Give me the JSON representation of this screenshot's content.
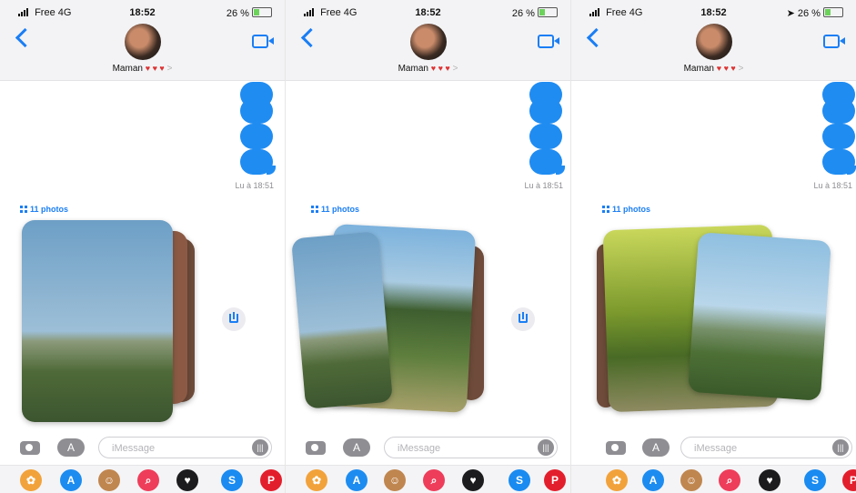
{
  "screens": [
    {
      "status": {
        "carrier": "Free",
        "network": "4G",
        "time": "18:52",
        "battery": "26 %"
      },
      "contact": {
        "name": "Maman",
        "hearts": "♥ ♥ ♥",
        "chevron": ">"
      },
      "read_receipt": "Lu à 18:51",
      "photos_label": "11 photos",
      "composer_placeholder": "iMessage"
    },
    {
      "status": {
        "carrier": "Free",
        "network": "4G",
        "time": "18:52",
        "battery": "26 %"
      },
      "contact": {
        "name": "Maman",
        "hearts": "♥ ♥ ♥",
        "chevron": ">"
      },
      "read_receipt": "Lu à 18:51",
      "photos_label": "11 photos",
      "composer_placeholder": "iMessage"
    },
    {
      "status": {
        "carrier": "Free",
        "network": "4G",
        "time": "18:52",
        "battery": "26 %"
      },
      "contact": {
        "name": "Maman",
        "hearts": "♥ ♥ ♥",
        "chevron": ">"
      },
      "read_receipt": "Lu à 18:51",
      "photos_label": "11 photos",
      "composer_placeholder": "iMessage"
    }
  ],
  "icons": {
    "back": "chevron-left-icon",
    "video": "video-camera-icon",
    "camera": "camera-icon",
    "apps": "app-store-icon",
    "audio": "audio-waveform-icon",
    "save": "download-icon",
    "grid": "grid-icon"
  },
  "drawer_apps": [
    {
      "name": "photos-app-icon",
      "color": "#f2a23b",
      "glyph": "✿"
    },
    {
      "name": "app-store-app-icon",
      "color": "#1d8cf0",
      "glyph": "A"
    },
    {
      "name": "memoji-app-icon",
      "color": "#c0864f",
      "glyph": "☺"
    },
    {
      "name": "search-images-app-icon",
      "color": "#ee3d5a",
      "glyph": "⌕"
    },
    {
      "name": "digital-touch-app-icon",
      "color": "#1c1c1e",
      "glyph": "♥"
    },
    {
      "name": "shazam-app-icon",
      "color": "#1a8bf0",
      "glyph": "S"
    },
    {
      "name": "pinterest-app-icon",
      "color": "#e31e2c",
      "glyph": "P"
    }
  ],
  "colors": {
    "accent": "#1a7ef5",
    "bubble": "#1f8cf2"
  }
}
